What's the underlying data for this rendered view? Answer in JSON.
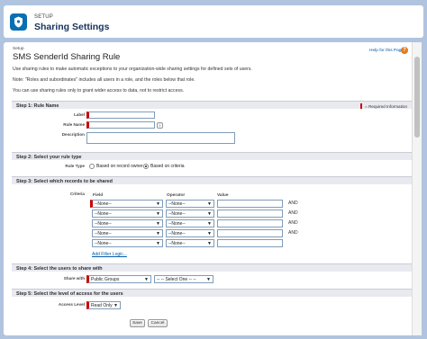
{
  "header": {
    "setup_label": "SETUP",
    "title": "Sharing Settings"
  },
  "page": {
    "breadcrumb": "Setup",
    "title": "SMS SenderId Sharing Rule",
    "help_link": "Help for this Page",
    "help_icon": "?",
    "intro": [
      "Use sharing rules to make automatic exceptions to your organization-wide sharing settings for defined sets of users.",
      "Note: \"Roles and subordinates\" includes all users in a role, and the roles below that role.",
      "You can use sharing rules only to grant wider access to data, not to restrict access."
    ]
  },
  "step1": {
    "title": "Step 1: Rule Name",
    "required_info": "= Required Information",
    "label_field": "Label",
    "rule_name_field": "Rule Name",
    "description_field": "Description",
    "info_icon": "i"
  },
  "step2": {
    "title": "Step 2: Select your rule type",
    "rule_type_label": "Rule Type",
    "option_owner": "Based on record owner",
    "option_criteria": "Based on criteria",
    "selected": "Based on criteria"
  },
  "step3": {
    "title": "Step 3: Select which records to be shared",
    "criteria_label": "Criteria",
    "col_field": "Field",
    "col_operator": "Operator",
    "col_value": "Value",
    "rows": [
      {
        "field": "--None--",
        "operator": "--None--",
        "value": "",
        "conj": "AND"
      },
      {
        "field": "--None--",
        "operator": "--None--",
        "value": "",
        "conj": "AND"
      },
      {
        "field": "--None--",
        "operator": "--None--",
        "value": "",
        "conj": "AND"
      },
      {
        "field": "--None--",
        "operator": "--None--",
        "value": "",
        "conj": "AND"
      },
      {
        "field": "--None--",
        "operator": "--None--",
        "value": "",
        "conj": ""
      }
    ],
    "add_filter_logic": "Add Filter Logic..."
  },
  "step4": {
    "title": "Step 4: Select the users to share with",
    "share_with_label": "Share with",
    "share_with_value": "Public Groups",
    "select_one_value": "-- -- Select One -- --"
  },
  "step5": {
    "title": "Step 5: Select the level of access for the users",
    "access_level_label": "Access Level",
    "access_level_value": "Read Only"
  },
  "buttons": {
    "save": "Save",
    "cancel": "Cancel"
  },
  "colors": {
    "brand": "#0a6fb2",
    "required": "#cc0000",
    "link": "#015ba7",
    "background": "#b0c4df"
  }
}
